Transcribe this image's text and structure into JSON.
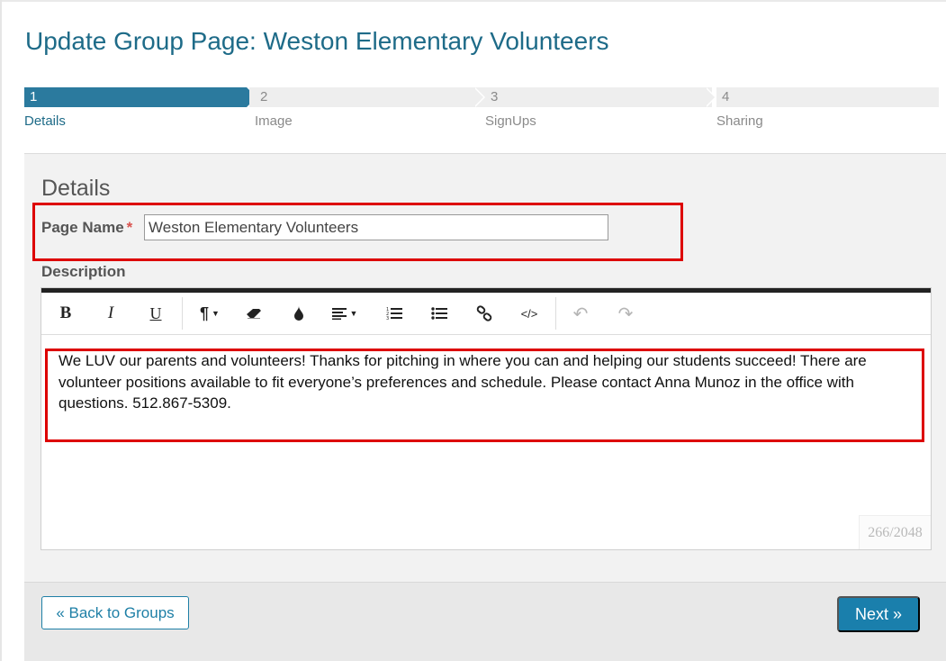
{
  "page": {
    "title": "Update Group Page: Weston Elementary Volunteers"
  },
  "stepper": {
    "steps": [
      {
        "number": "1",
        "label": "Details",
        "active": true
      },
      {
        "number": "2",
        "label": "Image",
        "active": false
      },
      {
        "number": "3",
        "label": "SignUps",
        "active": false
      },
      {
        "number": "4",
        "label": "Sharing",
        "active": false
      }
    ]
  },
  "details": {
    "section_title": "Details",
    "page_name_label": "Page Name",
    "required_marker": "*",
    "page_name_value": "Weston Elementary Volunteers",
    "description_label": "Description",
    "description_text": "We LUV our parents and volunteers! Thanks for pitching in where you can and helping our students succeed! There are volunteer positions available to fit everyone’s preferences and schedule. Please contact Anna Munoz in the office with questions. 512.867-5309.",
    "char_counter": "266/2048"
  },
  "toolbar": {
    "items": [
      "bold-icon",
      "italic-icon",
      "underline-icon",
      "paragraph-icon",
      "eraser-icon",
      "color-drop-icon",
      "align-icon",
      "ordered-list-icon",
      "unordered-list-icon",
      "link-icon",
      "code-icon",
      "undo-icon",
      "redo-icon"
    ]
  },
  "footer": {
    "back_label": "« Back to Groups",
    "next_label": "Next »"
  },
  "colors": {
    "title": "#1e6b88",
    "step_active": "#2b7a9e",
    "highlight": "#dd0000",
    "primary_button": "#1a7fac"
  }
}
